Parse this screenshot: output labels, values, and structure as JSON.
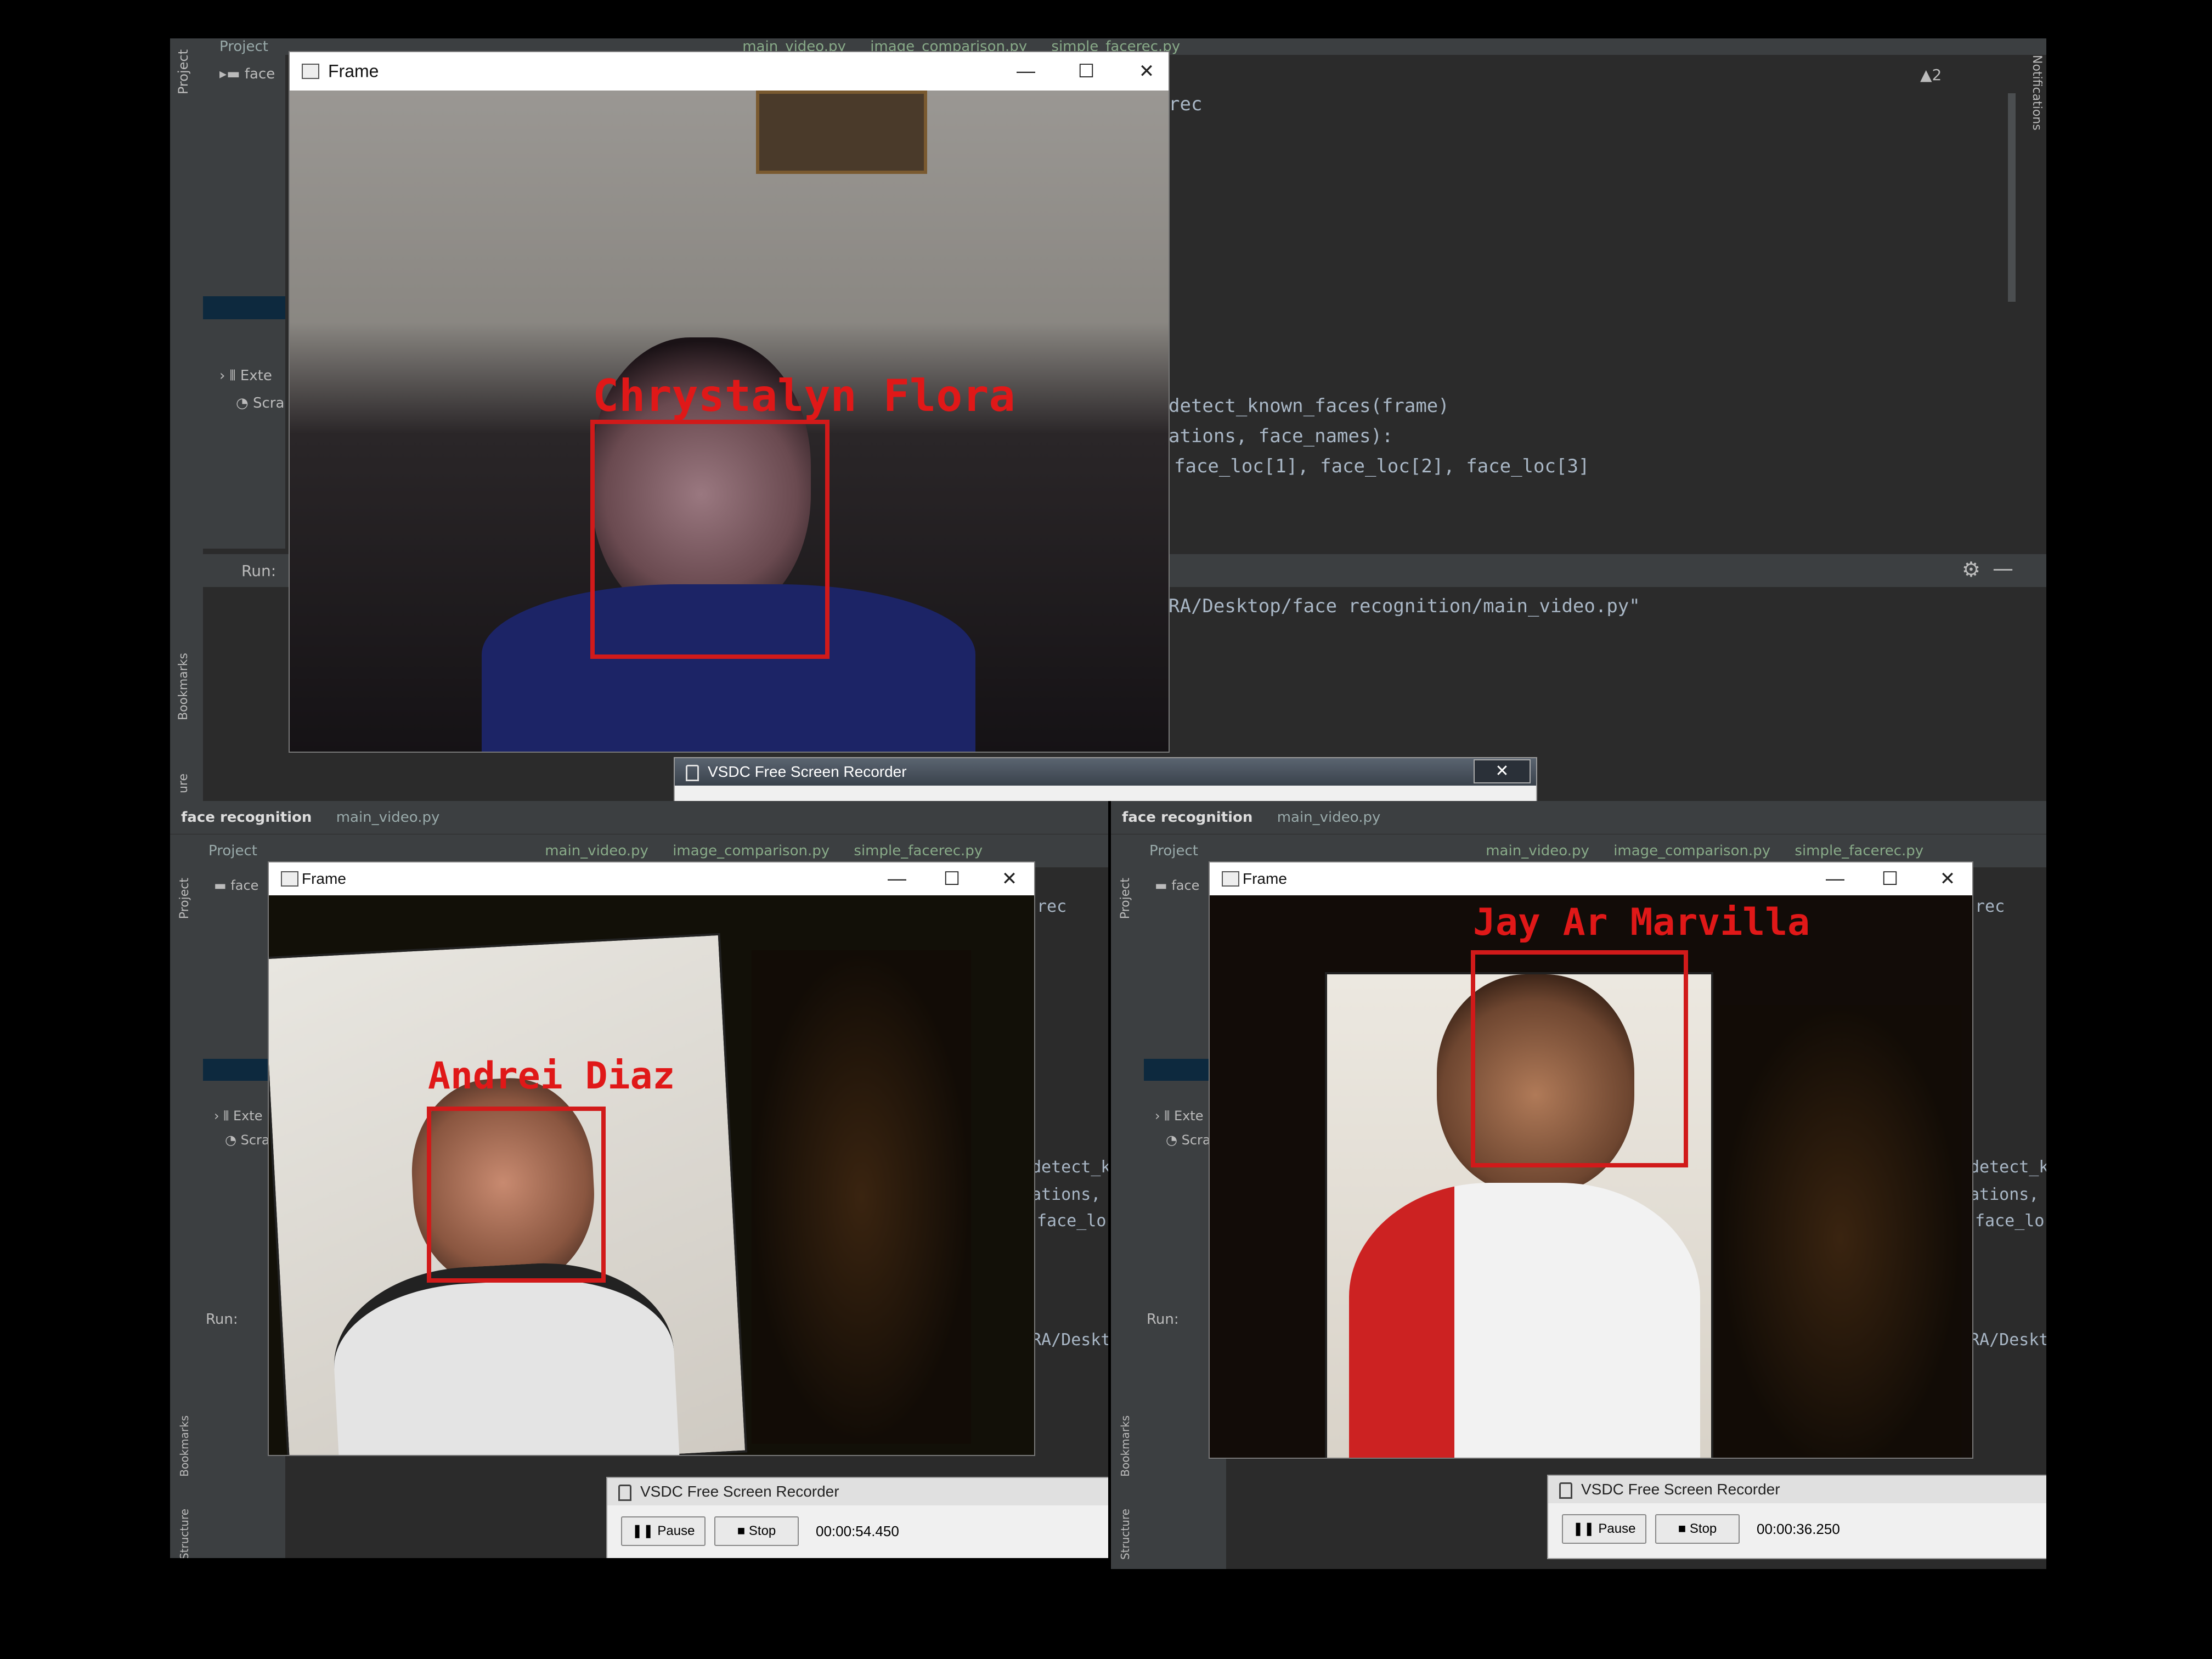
{
  "top": {
    "toolbar": {
      "project_label": "Project",
      "tabs": [
        "main_video.py",
        "image_comparison.py",
        "simple_facerec.py"
      ]
    },
    "editor_lines": [
      "rec",
      "detect_known_faces(frame)",
      "ations, face_names):",
      "face_loc[1], face_loc[2], face_loc[3]"
    ],
    "run_label": "Run:",
    "run_path": "RA/Desktop/face recognition/main_video.py\"",
    "warnings": "▲2",
    "tree_items": [
      "face",
      "Exte",
      "Scra"
    ],
    "frame": {
      "title": "Frame",
      "person_name": "Chrystalyn Flora"
    },
    "recorder": {
      "title": "VSDC Free Screen Recorder"
    },
    "side_labels": {
      "project": "Project",
      "bookmarks": "Bookmarks",
      "notifications": "Notifications",
      "structure": "ure"
    }
  },
  "bottom_left": {
    "breadcrumb": [
      "face recognition",
      "main_video.py"
    ],
    "toolbar": {
      "project_label": "Project",
      "tabs": [
        "main_video.py",
        "image_comparison.py",
        "simple_facerec.py"
      ]
    },
    "editor_lines": [
      "rec",
      "detect_k",
      "ations,",
      "face_lo"
    ],
    "run_label": "Run:",
    "run_path": "RA/Deskt",
    "tree_items": [
      "face",
      "Exte",
      "Scra"
    ],
    "frame": {
      "title": "Frame",
      "person_name": "Andrei Diaz"
    },
    "recorder": {
      "title": "VSDC Free Screen Recorder",
      "pause": "Pause",
      "stop": "Stop",
      "time": "00:00:54.450"
    },
    "side_labels": {
      "project": "Project",
      "bookmarks": "Bookmarks",
      "structure": "Structure"
    }
  },
  "bottom_right": {
    "breadcrumb": [
      "face recognition",
      "main_video.py"
    ],
    "toolbar": {
      "project_label": "Project",
      "tabs": [
        "main_video.py",
        "image_comparison.py",
        "simple_facerec.py"
      ]
    },
    "editor_lines": [
      "rec",
      "detect_k",
      "ations,",
      "face_lo"
    ],
    "run_label": "Run:",
    "run_path": "RA/Deskt",
    "tree_items": [
      "face",
      "Exte",
      "Scra"
    ],
    "frame": {
      "title": "Frame",
      "person_name": "Jay Ar Marvilla"
    },
    "recorder": {
      "title": "VSDC Free Screen Recorder",
      "pause": "Pause",
      "stop": "Stop",
      "time": "00:00:36.250"
    },
    "side_labels": {
      "project": "Project",
      "bookmarks": "Bookmarks",
      "structure": "Structure"
    }
  },
  "colors": {
    "ide_bg": "#2b2b2b",
    "ide_panel": "#3c3f41",
    "face_box": "#d11a1a"
  },
  "icons": [
    "minimize-icon",
    "maximize-icon",
    "close-icon",
    "pause-icon",
    "stop-icon",
    "folder-icon",
    "python-file-icon"
  ]
}
